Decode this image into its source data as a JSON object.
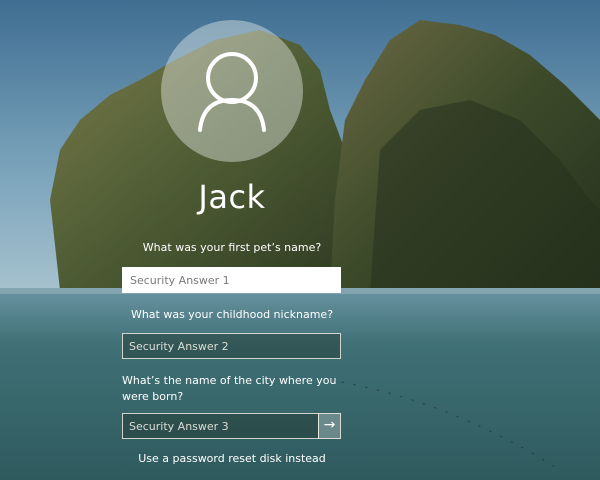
{
  "user": {
    "name": "Jack"
  },
  "questions": [
    {
      "text": "What was your first pet’s name?",
      "placeholder": "Security Answer 1"
    },
    {
      "text": "What was your childhood nickname?",
      "placeholder": "Security Answer 2"
    },
    {
      "text": "What’s the name of the city where you were born?",
      "placeholder": "Security Answer 3"
    }
  ],
  "submit": {
    "icon": "arrow-right-icon",
    "glyph": "→"
  },
  "reset_link": "Use a password reset disk instead",
  "colors": {
    "text": "#ffffff",
    "sky": "#4f7d9a",
    "water": "#3f6f76",
    "cliff": "#4a5a36"
  }
}
